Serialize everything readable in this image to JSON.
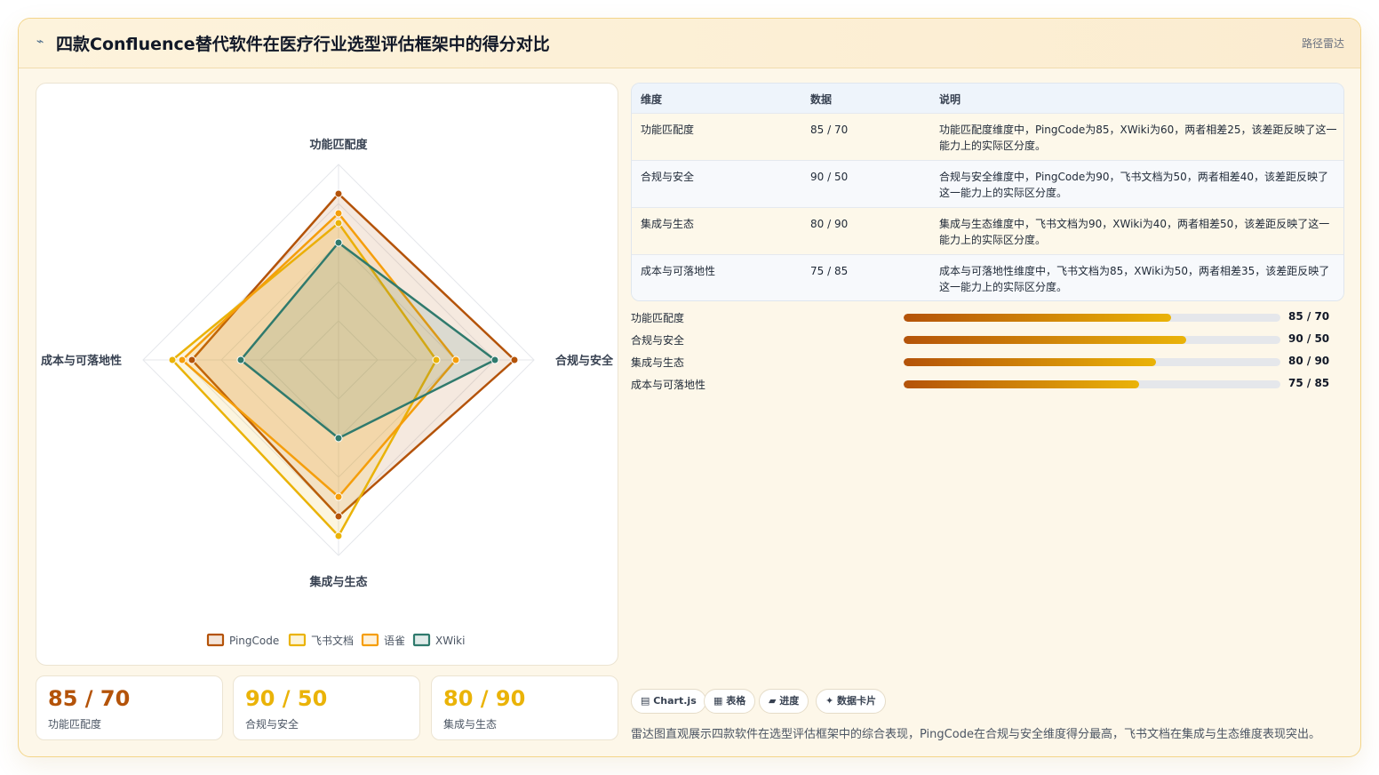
{
  "header": {
    "icon": "route-icon",
    "title": "四款Confluence替代软件在医疗行业选型评估框架中的得分对比",
    "tag": "路径雷达"
  },
  "chart_data": {
    "type": "radar",
    "axes": [
      "功能匹配度",
      "合规与安全",
      "集成与生态",
      "成本与可落地性"
    ],
    "rmax": 100,
    "grid": true,
    "legend_position": "bottom",
    "series": [
      {
        "name": "PingCode",
        "values": [
          85,
          90,
          80,
          75
        ],
        "color": "#b45309"
      },
      {
        "name": "飞书文档",
        "values": [
          70,
          50,
          90,
          85
        ],
        "color": "#eab308"
      },
      {
        "name": "语雀",
        "values": [
          75,
          60,
          70,
          80
        ],
        "color": "#f59e0b"
      },
      {
        "name": "XWiki",
        "values": [
          60,
          80,
          40,
          50
        ],
        "color": "#2f7a6d"
      }
    ]
  },
  "kpis": [
    {
      "value": "85 / 70",
      "label": "功能匹配度",
      "color": "#b45309"
    },
    {
      "value": "90 / 50",
      "label": "合规与安全",
      "color": "#eab308"
    },
    {
      "value": "80 / 90",
      "label": "集成与生态",
      "color": "#eab308"
    }
  ],
  "table": {
    "headers": [
      "维度",
      "数据",
      "说明"
    ],
    "rows": [
      {
        "dim": "功能匹配度",
        "data": "85 / 70",
        "desc": "功能匹配度维度中，PingCode为85，XWiki为60，两者相差25，该差距反映了这一能力上的实际区分度。"
      },
      {
        "dim": "合规与安全",
        "data": "90 / 50",
        "desc": "合规与安全维度中，PingCode为90，飞书文档为50，两者相差40，该差距反映了这一能力上的实际区分度。"
      },
      {
        "dim": "集成与生态",
        "data": "80 / 90",
        "desc": "集成与生态维度中，飞书文档为90，XWiki为40，两者相差50，该差距反映了这一能力上的实际区分度。"
      },
      {
        "dim": "成本与可落地性",
        "data": "75 / 85",
        "desc": "成本与可落地性维度中，飞书文档为85，XWiki为50，两者相差35，该差距反映了这一能力上的实际区分度。"
      }
    ]
  },
  "progress": [
    {
      "label": "功能匹配度",
      "value": "85 / 70",
      "fill": 0.71
    },
    {
      "label": "合规与安全",
      "value": "90 / 50",
      "fill": 0.75
    },
    {
      "label": "集成与生态",
      "value": "80 / 90",
      "fill": 0.67
    },
    {
      "label": "成本与可落地性",
      "value": "75 / 85",
      "fill": 0.625
    }
  ],
  "chips": [
    "Chart.js",
    "表格",
    "进度",
    "数据卡片"
  ],
  "footnote": "雷达图直观展示四款软件在选型评估框架中的综合表现，PingCode在合规与安全维度得分最高，飞书文档在集成与生态维度表现突出。"
}
